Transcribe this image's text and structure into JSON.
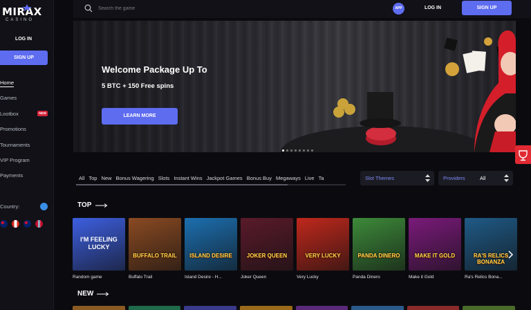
{
  "brand": {
    "logo_text": "MIRAX",
    "logo_sub": "CASINO"
  },
  "sidebar": {
    "login_label": "LOG IN",
    "signup_label": "SIGN UP",
    "items": [
      {
        "label": "Home",
        "active": true
      },
      {
        "label": "Games"
      },
      {
        "label": "Lootbox",
        "badge": "NEW"
      },
      {
        "label": "Promotions"
      },
      {
        "label": "Tournaments"
      },
      {
        "label": "VIP Program"
      },
      {
        "label": "Payments"
      }
    ],
    "country_label": "Country:"
  },
  "header": {
    "search_placeholder": "Search the game",
    "app_label": "APP",
    "login_label": "LOG IN",
    "signup_label": "SIGN UP"
  },
  "banner": {
    "title": "Welcome Package Up To",
    "subtitle": "5 BTC + 150 Free spins",
    "cta_label": "LEARN MORE",
    "slides": 8,
    "active_slide": 1
  },
  "filters": {
    "tabs": [
      "All",
      "Top",
      "New",
      "Bonus Wagering",
      "Slots",
      "Instant Wins",
      "Jackpot Games",
      "Bonus Buy",
      "Megaways",
      "Live",
      "Ta"
    ],
    "slot_themes_label": "Slot Themes",
    "providers_label": "Providers",
    "providers_value": "All"
  },
  "sections": {
    "top_title": "TOP",
    "new_title": "NEW"
  },
  "games": [
    {
      "name": "Random game",
      "thumb_text": "I'M FEELING LUCKY",
      "bg": "#3d5fe0"
    },
    {
      "name": "Buffalo Trail",
      "thumb_text": "BUFFALO TRAIL",
      "bg": "#8a4a22"
    },
    {
      "name": "Island Desire - H...",
      "thumb_text": "ISLAND DESIRE",
      "bg": "#1c6fb0"
    },
    {
      "name": "Joker Queen",
      "thumb_text": "JOKER QUEEN",
      "bg": "#5a1a2a"
    },
    {
      "name": "Very Lucky",
      "thumb_text": "VERY LUCKY",
      "bg": "#c0281c"
    },
    {
      "name": "Panda Dinero",
      "thumb_text": "PANDA DINERO",
      "bg": "#3d8a3a"
    },
    {
      "name": "Make it Gold",
      "thumb_text": "MAKE IT GOLD",
      "bg": "#7a1a7a"
    },
    {
      "name": "Ra's Relics Bona...",
      "thumb_text": "RA'S RELICS BONANZA",
      "bg": "#1f5a86"
    }
  ],
  "colors": {
    "accent": "#5e6cf0",
    "hot": "#d6243a",
    "bg": "#0b0b0f"
  }
}
